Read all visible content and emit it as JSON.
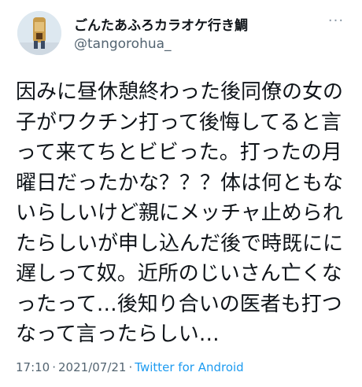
{
  "author": {
    "display_name": "ごんたあふろカラオケ行き鯛",
    "handle": "@tangorohua_"
  },
  "more_button_icon": "more-horizontal-icon",
  "tweet": {
    "lines": [
      "因みに昼休憩終わった後同僚の女の",
      "子がワクチン打って後悔してると言",
      "って来てちとビビった。打ったの月",
      "曜日だったかな？？？体は何ともな",
      "いらしいけど親にメッチャ止められ",
      "たらしいが申し込んだ後で時既にに",
      "遅しって奴。近所のじいさん亡くな",
      "ったって…後知り合いの医者も打つ",
      "なって言ったらしい…"
    ]
  },
  "meta": {
    "time": "17:10",
    "separator": "·",
    "date": "2021/07/21",
    "source": "Twitter for Android"
  },
  "colors": {
    "text": "#0f1419",
    "secondary": "#536471",
    "link": "#1d9bf0"
  }
}
